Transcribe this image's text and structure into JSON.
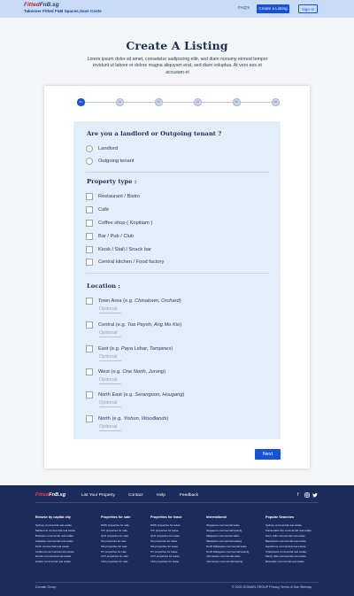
{
  "header": {
    "logo_part1": "Fitted",
    "logo_part2": "FnB.sg",
    "tagline": "Takeover Fitted F&B Spaces,Save Costs",
    "faq": "FAQ's",
    "create_listing": "Create a Listing",
    "sign_in": "Sign In"
  },
  "page": {
    "title": "Create A Listing",
    "intro": "Lorem ipsum dolor sit amet, consetetur sadipscing elitr, sed diam nonumy eirmod tempor invidunt ut labore et dolore magna aliquyam erat, sed diam voluptua. At vero eos et accusam et"
  },
  "stepper": {
    "steps": [
      "01",
      "02",
      "03",
      "04",
      "05",
      "06"
    ],
    "active_index": 0
  },
  "form": {
    "q1": "Are you a landlord or Outgoing tenant ?",
    "q1_options": [
      "Landlord",
      "Outgoing tenant"
    ],
    "q2": "Property type :",
    "q2_options": [
      "Restaurant / Bistro",
      "Café",
      "Coffee shop ( Kopitiam )",
      "Bar / Pub / Club",
      "Kiosk / Stall / Snack bar",
      "Central kitchen / Food factory"
    ],
    "q3": "Location :",
    "locations": [
      {
        "name": "Town Area (e.g. ",
        "example": "Chinatown, Orchard",
        "close": ")",
        "optional": "Optional"
      },
      {
        "name": "Central (e.g. ",
        "example": "Toa Payoh, Ang Mo Kio",
        "close": ")",
        "optional": "Optional"
      },
      {
        "name": "East (e.g. ",
        "example": "Paya Lebar, Tampines",
        "close": ")",
        "optional": "Optional"
      },
      {
        "name": "West (e.g. ",
        "example": "One North, Jurong",
        "close": ")",
        "optional": "Optional"
      },
      {
        "name": "North East (e.g. ",
        "example": "Serangoon, Hougang",
        "close": ")",
        "optional": "Optional"
      },
      {
        "name": "North (e.g. ",
        "example": "Yishun, Woodlands",
        "close": ")",
        "optional": "Optional"
      }
    ],
    "next": "Next"
  },
  "footer": {
    "logo_part1": "Fitted",
    "logo_part2": "FnB.sg",
    "nav": [
      "List Your Property",
      "Contact",
      "Help",
      "Feedback"
    ],
    "social_icons": [
      "facebook-icon",
      "instagram-icon",
      "twitter-icon"
    ],
    "columns": [
      {
        "heading": "Browse by capital city",
        "links": [
          "Sydney commercial real estate",
          "Melbourne commercial real estate",
          "Brisbane commercial real estate",
          "Adelaide commercial real estate",
          "Perth commercial real estate",
          "Canberra commercial real estate",
          "Darwin commercial real estate",
          "Hobart commercial real estate"
        ]
      },
      {
        "heading": "Properties for sale",
        "links": [
          "NSW properties for sale",
          "VIC properties for sale",
          "QLD properties for sale",
          "SA properties for sale",
          "WA properties for sale",
          "NT properties for sale",
          "ACT properties for sale",
          "TAS properties for sale"
        ]
      },
      {
        "heading": "Properties for lease",
        "links": [
          "NSW properties for lease",
          "VIC properties for lease",
          "QLD properties for lease",
          "SA properties for lease",
          "WA properties for lease",
          "NT properties for lease",
          "ACT properties for lease",
          "TAS properties for lease"
        ]
      },
      {
        "heading": "International",
        "links": [
          "Singapore commercial sales",
          "Singapore commercial leasing",
          "Malaysian commercial sales",
          "Malaysian commercial leasing",
          "North Malaysian commercial sales",
          "North Malaysian commercial leasing",
          "Indonesian commercial sales",
          "Indonesian commercial leasing"
        ]
      },
      {
        "heading": "Popular Searches",
        "links": [
          "Sydney commercial real estate",
          "Parramatta City commercial real estate",
          "Surry Hills commercial real estate",
          "Bankstown commercial real estate",
          "Sandstone commercial real estate",
          "Chatswood commercial real estate",
          "Manly Vale commercial real estate",
          "Rosedale commercial real estate"
        ]
      }
    ],
    "bottom_left": "Domain Group",
    "bottom_right": "© 2020 DOMAIN GROUP Privacy Terms of Use Sitemap"
  },
  "colors": {
    "header_bg": "#c9dcf7",
    "accent": "#1853d6",
    "panel_bg": "#e3eefd",
    "footer_bg": "#1b2c5c"
  }
}
